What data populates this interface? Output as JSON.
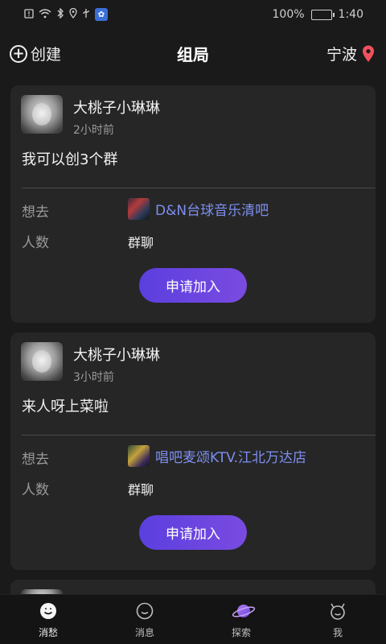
{
  "status_bar": {
    "battery_text": "100%",
    "time": "1:40",
    "icons": [
      "alert-icon",
      "wifi-icon",
      "bluetooth-icon",
      "location-icon",
      "usb-icon",
      "app-badge-icon"
    ]
  },
  "header": {
    "create_label": "创建",
    "title": "组局",
    "city": "宁波"
  },
  "posts": [
    {
      "user_name": "大桃子小琳琳",
      "time": "2小时前",
      "text": "我可以创3个群",
      "want_label": "想去",
      "venue": "D&N台球音乐清吧",
      "people_label": "人数",
      "people_value": "群聊",
      "join_label": "申请加入"
    },
    {
      "user_name": "大桃子小琳琳",
      "time": "3小时前",
      "text": "来人呀上菜啦",
      "want_label": "想去",
      "venue": "唱吧麦颂KTV.江北万达店",
      "people_label": "人数",
      "people_value": "群聊",
      "join_label": "申请加入"
    }
  ],
  "bottom_nav": [
    {
      "label": "消愁",
      "icon": "smile-face-icon",
      "active": true
    },
    {
      "label": "消息",
      "icon": "message-face-icon",
      "active": false
    },
    {
      "label": "探索",
      "icon": "planet-icon",
      "active": false
    },
    {
      "label": "我",
      "icon": "devil-face-icon",
      "active": false
    }
  ],
  "colors": {
    "accent": "#6a45e0",
    "link": "#7d8ff0",
    "pin": "#f0525c",
    "background": "#1a1a1a",
    "card": "#262626"
  }
}
